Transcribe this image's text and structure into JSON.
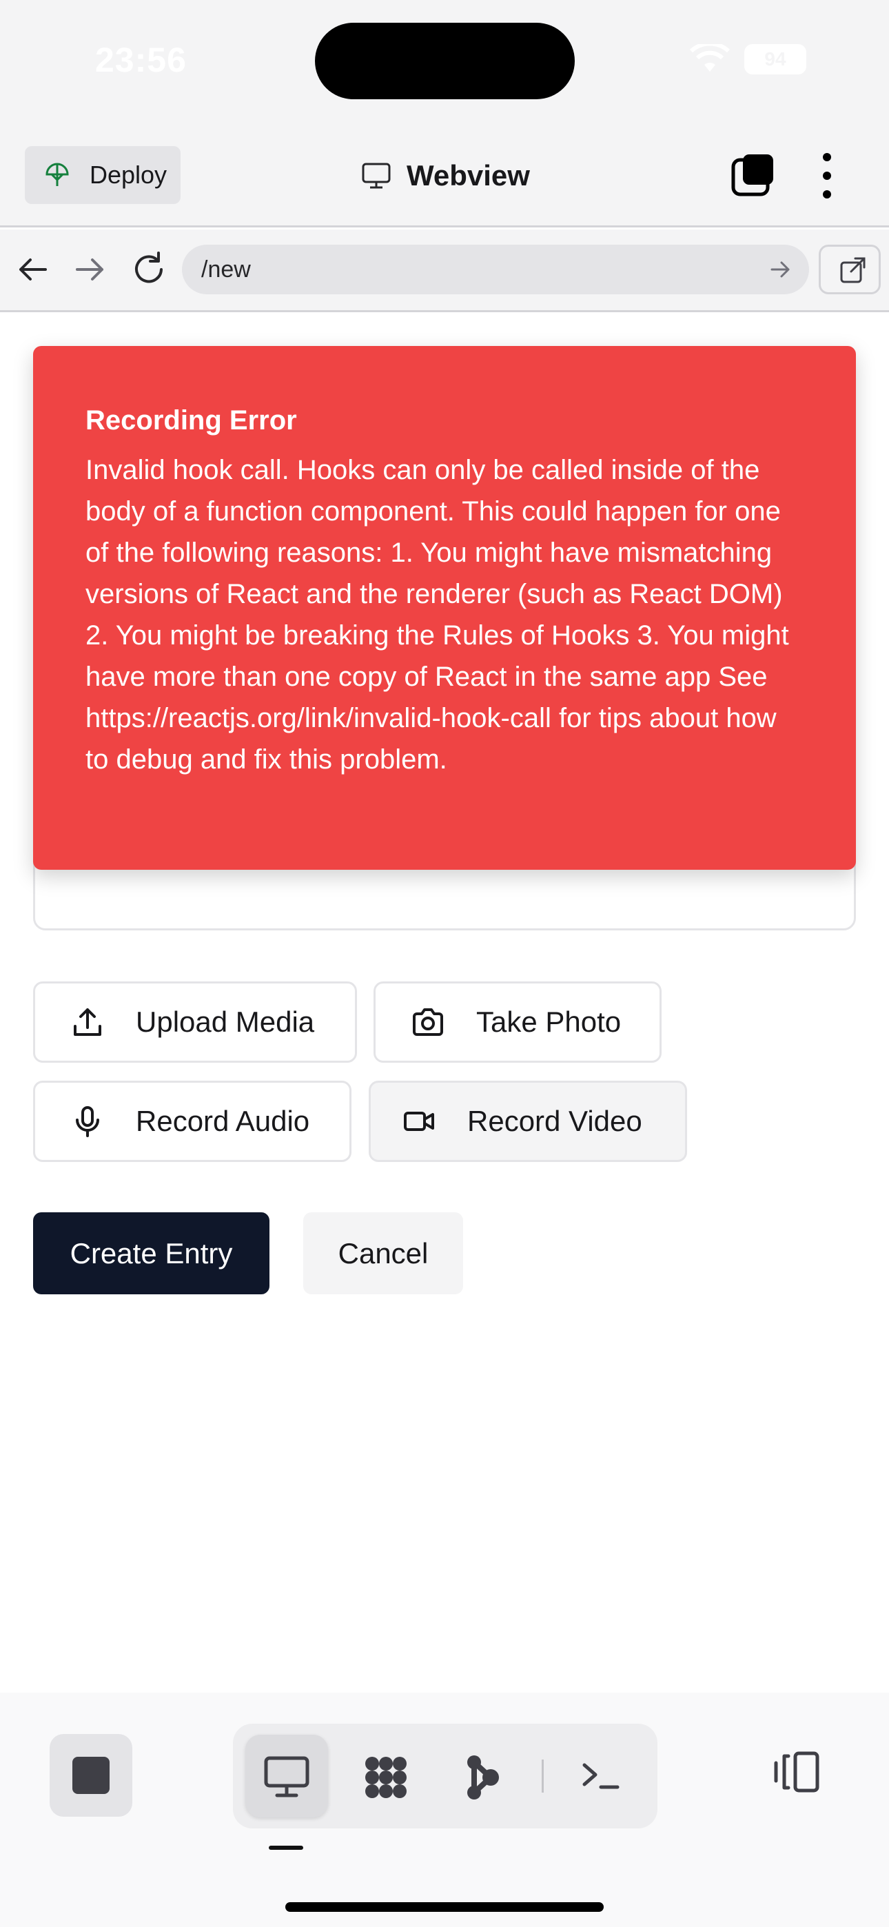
{
  "status_bar": {
    "time": "23:56",
    "battery": "94"
  },
  "header": {
    "deploy_label": "Deploy",
    "title": "Webview"
  },
  "url_bar": {
    "value": "/new"
  },
  "error_toast": {
    "title": "Recording Error",
    "message": "Invalid hook call. Hooks can only be called inside of the body of a function component. This could happen for one of the following reasons: 1. You might have mismatching versions of React and the renderer (such as React DOM) 2. You might be breaking the Rules of Hooks 3. You might have more than one copy of React in the same app See https://reactjs.org/link/invalid-hook-call for tips about how to debug and fix this problem."
  },
  "media_buttons": {
    "upload": "Upload Media",
    "photo": "Take Photo",
    "audio": "Record Audio",
    "video": "Record Video"
  },
  "actions": {
    "create": "Create Entry",
    "cancel": "Cancel"
  },
  "icons": {
    "deploy": "umbrella-icon",
    "webview": "monitor-icon",
    "tabs": "tabs-icon",
    "more": "more-vertical-icon",
    "back": "arrow-left-icon",
    "forward": "arrow-right-icon",
    "reload": "reload-icon",
    "open_external": "external-link-icon",
    "upload": "upload-icon",
    "photo": "camera-icon",
    "audio": "microphone-icon",
    "video": "video-icon",
    "stop": "stop-icon",
    "preview": "monitor-icon",
    "nodes": "nodes-icon",
    "agent": "agent-icon",
    "terminal": "terminal-icon",
    "panel": "panel-toggle-icon"
  },
  "colors": {
    "error": "#ef4444",
    "primary": "#0f172a",
    "chrome": "#f4f4f5",
    "deploy_icon": "#15803d"
  }
}
